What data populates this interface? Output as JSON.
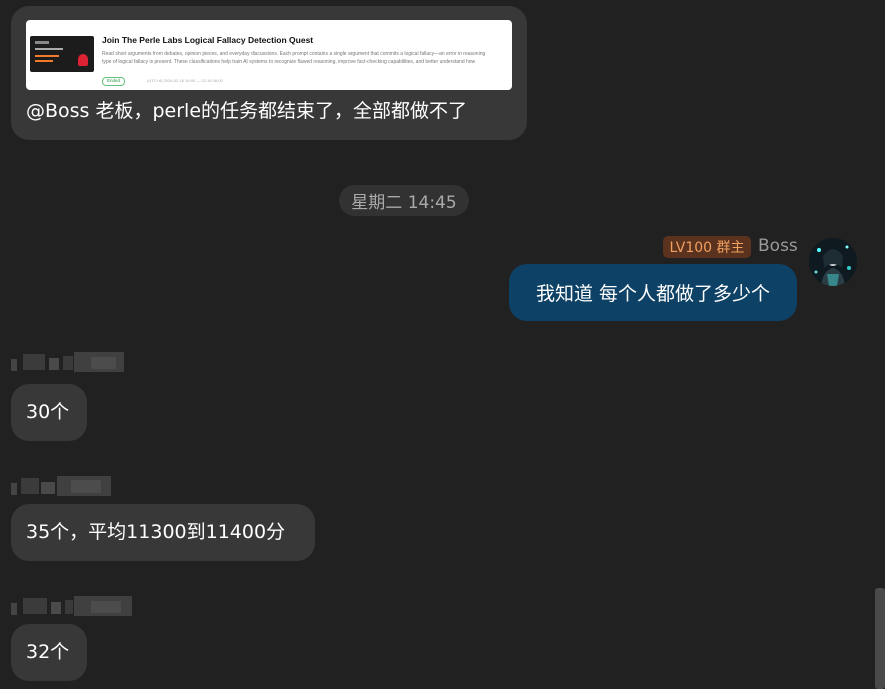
{
  "shared_message": {
    "card_title": "Join The Perle Labs Logical Fallacy Detection Quest",
    "card_desc_line1": "Read short arguments from debates, opinion pieces, and everyday discussions. Each prompt contains a single argument that commits a logical fallacy—an error in reasoning",
    "card_desc_line2": "type of logical fallacy is present. These classifications help train AI systems to recognize flawed reasoning, improve fact-checking capabilities, and better understand how",
    "card_badge": "Ended",
    "card_meta": "(UTC+8) 2026-02-16 16:00 — 02-18 08:00",
    "text": "@Boss 老板，perle的任务都结束了，全部都做不了"
  },
  "time_divider": "星期二 14:45",
  "boss_message": {
    "badge": "LV100 群主",
    "sender": "Boss",
    "text": "我知道 每个人都做了多少个"
  },
  "replies": [
    {
      "text": "30个"
    },
    {
      "text": "35个，平均11300到11400分"
    },
    {
      "text": "32个"
    }
  ],
  "colors": {
    "background": "#212121",
    "bubble_incoming": "#383838",
    "bubble_outgoing": "#0e4166",
    "badge_text": "#f0a060",
    "badge_bg": "#5a321d"
  }
}
